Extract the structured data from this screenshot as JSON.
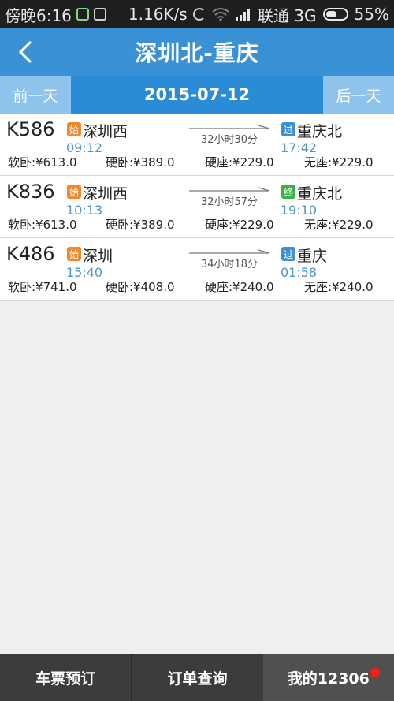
{
  "status_bar": {
    "time_label": "傍晚6:16",
    "speed": "1.16K/s",
    "carrier": "联通 3G",
    "battery": "55%",
    "battery_level": 0.55,
    "icons": [
      "shield-icon",
      "app-icon",
      "sync-icon",
      "wifi-icon",
      "signal-icon",
      "battery-icon"
    ]
  },
  "header": {
    "title": "深圳北-重庆",
    "back_icon": "chevron-left-icon"
  },
  "datebar": {
    "prev_label": "前一天",
    "date": "2015-07-12",
    "next_label": "后一天"
  },
  "trains": [
    {
      "code": "K586",
      "from_badge": "始",
      "from_station": "深圳西",
      "from_time": "09:12",
      "duration": "32小时30分",
      "to_badge": "过",
      "to_badge_color": "#3b91d6",
      "to_station": "重庆北",
      "to_time": "17:42",
      "prices": [
        "软卧:¥613.0",
        "硬卧:¥389.0",
        "硬座:¥229.0",
        "无座:¥229.0"
      ]
    },
    {
      "code": "K836",
      "from_badge": "始",
      "from_station": "深圳西",
      "from_time": "10:13",
      "duration": "32小时57分",
      "to_badge": "终",
      "to_badge_color": "#3cb04a",
      "to_station": "重庆北",
      "to_time": "19:10",
      "prices": [
        "软卧:¥613.0",
        "硬卧:¥389.0",
        "硬座:¥229.0",
        "无座:¥229.0"
      ]
    },
    {
      "code": "K486",
      "from_badge": "始",
      "from_station": "深圳",
      "from_time": "15:40",
      "duration": "34小时18分",
      "to_badge": "过",
      "to_badge_color": "#3b91d6",
      "to_station": "重庆",
      "to_time": "01:58",
      "prices": [
        "软卧:¥741.0",
        "硬卧:¥408.0",
        "硬座:¥240.0",
        "无座:¥240.0"
      ]
    }
  ],
  "bottom_nav": {
    "tabs": [
      {
        "label": "车票预订",
        "active": false
      },
      {
        "label": "订单查询",
        "active": false
      },
      {
        "label": "我的12306",
        "active": true,
        "notification": true
      }
    ]
  },
  "colors": {
    "header": "#3b91d6",
    "datebar": "#2a8bd6",
    "start_badge": "#f0892b",
    "time_text": "#4f95c8",
    "notification_dot": "#ff1a1a"
  }
}
